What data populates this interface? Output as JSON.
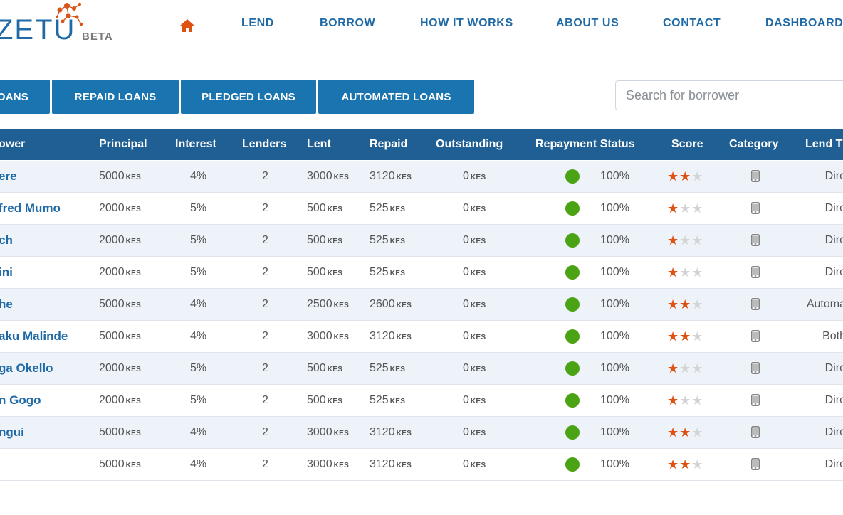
{
  "brand": {
    "name": "ZETU",
    "tag": "BETA"
  },
  "nav": {
    "items": [
      "LEND",
      "BORROW",
      "HOW IT WORKS",
      "ABOUT US",
      "CONTACT",
      "DASHBOARD"
    ]
  },
  "tabs": [
    "OANS",
    "REPAID LOANS",
    "PLEDGED LOANS",
    "AUTOMATED LOANS"
  ],
  "search": {
    "placeholder": "Search for borrower"
  },
  "table": {
    "headers": [
      "ower",
      "Principal",
      "Interest",
      "Lenders",
      "Lent",
      "Repaid",
      "Outstanding",
      "Repayment Status",
      "Score",
      "Category",
      "Lend T"
    ],
    "unit": "KES",
    "rows": [
      {
        "name": "ere",
        "principal": "5000",
        "interest": "4%",
        "lenders": "2",
        "lent": "3000",
        "repaid": "3120",
        "outstanding": "0",
        "status": "100%",
        "score": 2,
        "lend_type": "Dire"
      },
      {
        "name": "fred Mumo",
        "principal": "2000",
        "interest": "5%",
        "lenders": "2",
        "lent": "500",
        "repaid": "525",
        "outstanding": "0",
        "status": "100%",
        "score": 1,
        "lend_type": "Dire"
      },
      {
        "name": "ch",
        "principal": "2000",
        "interest": "5%",
        "lenders": "2",
        "lent": "500",
        "repaid": "525",
        "outstanding": "0",
        "status": "100%",
        "score": 1,
        "lend_type": "Dire"
      },
      {
        "name": "ini",
        "principal": "2000",
        "interest": "5%",
        "lenders": "2",
        "lent": "500",
        "repaid": "525",
        "outstanding": "0",
        "status": "100%",
        "score": 1,
        "lend_type": "Dire"
      },
      {
        "name": "he",
        "principal": "5000",
        "interest": "4%",
        "lenders": "2",
        "lent": "2500",
        "repaid": "2600",
        "outstanding": "0",
        "status": "100%",
        "score": 2,
        "lend_type": "Automa"
      },
      {
        "name": "aku Malinde",
        "principal": "5000",
        "interest": "4%",
        "lenders": "2",
        "lent": "3000",
        "repaid": "3120",
        "outstanding": "0",
        "status": "100%",
        "score": 2,
        "lend_type": "Both"
      },
      {
        "name": "ga Okello",
        "principal": "2000",
        "interest": "5%",
        "lenders": "2",
        "lent": "500",
        "repaid": "525",
        "outstanding": "0",
        "status": "100%",
        "score": 1,
        "lend_type": "Dire"
      },
      {
        "name": "n Gogo",
        "principal": "2000",
        "interest": "5%",
        "lenders": "2",
        "lent": "500",
        "repaid": "525",
        "outstanding": "0",
        "status": "100%",
        "score": 1,
        "lend_type": "Dire"
      },
      {
        "name": "ngui",
        "principal": "5000",
        "interest": "4%",
        "lenders": "2",
        "lent": "3000",
        "repaid": "3120",
        "outstanding": "0",
        "status": "100%",
        "score": 2,
        "lend_type": "Dire"
      },
      {
        "name": "",
        "principal": "5000",
        "interest": "4%",
        "lenders": "2",
        "lent": "3000",
        "repaid": "3120",
        "outstanding": "0",
        "status": "100%",
        "score": 2,
        "lend_type": "Dire"
      }
    ],
    "max_score": 3
  },
  "colors": {
    "brand_blue": "#1f6aa6",
    "header_bg": "#1f5f93",
    "tab_bg": "#1a74b0",
    "accent_orange": "#de5113",
    "status_green": "#4aa314"
  },
  "icons": {
    "home": "home-icon",
    "category": "mobile-phone-icon",
    "status": "status-dot-icon",
    "score": "star-icon"
  }
}
